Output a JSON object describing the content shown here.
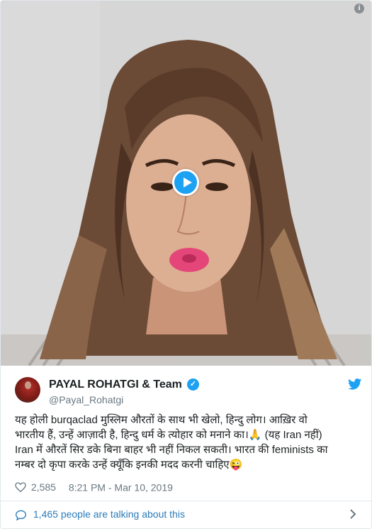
{
  "tweet": {
    "display_name": "PAYAL ROHATGI & Team",
    "handle": "@Payal_Rohatgi",
    "text_lines": [
      "यह होली burqaclad मुस्लिम औरतों के साथ भी खेलो, हिन्दु लोग। आख़िर वो",
      "भारतीय हैं, उन्हें आज़ादी है, हिन्दु धर्म के त्योहार को मनाने का।",
      "(यह Iran नहीं)",
      "Iran में औरतें सिर डके बिना बाहर भी नहीं निकल सकती। भारत की feminists का",
      "नम्बर दो कृपा करके उन्हें क्यूँकि इनकी मदद करनी चाहिए"
    ],
    "emoji_pray": "🙏",
    "emoji_wink": "😜",
    "like_count": "2,585",
    "timestamp": "8:21 PM - Mar 10, 2019"
  },
  "media": {
    "info_label": "i"
  },
  "footer": {
    "talking_label": "1,465 people are talking about this"
  },
  "icons": {
    "verified": "checkmark",
    "brand": "twitter-bird",
    "like": "heart-outline",
    "reply": "speech-bubble",
    "more": "chevron-right"
  },
  "colors": {
    "accent": "#1da1f2",
    "link": "#2b7bb9",
    "muted": "#697882",
    "text": "#1c2022"
  }
}
